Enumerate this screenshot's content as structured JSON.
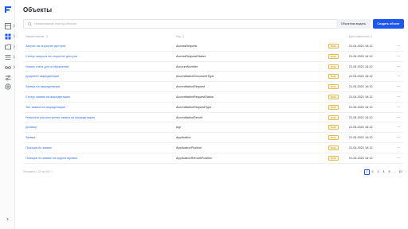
{
  "page": {
    "title": "Объекты"
  },
  "toolbar": {
    "search_placeholder": "Наименование или код объекта",
    "object_model_label": "Объектная модель",
    "create_label": "Создать объект"
  },
  "table": {
    "headers": {
      "name": "Наименование",
      "code": "Код",
      "changed": "Дата изменения"
    },
    "rows": [
      {
        "name": "Запрос на открытие доступа",
        "code": "AccessRequest",
        "badge": "Draft",
        "date": "21.04.2021  14:12"
      },
      {
        "name": "Статус запроса на открытие доступа",
        "code": "AccessRequestStatus",
        "badge": "Draft",
        "date": "21.04.2021  14:12"
      },
      {
        "name": "Номер счета для отображения",
        "code": "AccountNumber",
        "badge": "Draft",
        "date": "21.04.2021  14:12"
      },
      {
        "name": "Документ аккредитации",
        "code": "AccreditationDocumentType",
        "badge": "Draft",
        "date": "21.04.2021  14:12"
      },
      {
        "name": "Заявка на аккредитацию",
        "code": "AccreditationRequest",
        "badge": "Draft",
        "date": "21.04.2021  14:12"
      },
      {
        "name": "Статус заявки на аккредитацию",
        "code": "AccreditationRequestStatus",
        "badge": "Draft",
        "date": "21.04.2021  14:12"
      },
      {
        "name": "Тип заявки на аккредитацию",
        "code": "AccreditationRequestType",
        "badge": "Draft",
        "date": "21.04.2021  14:12"
      },
      {
        "name": "Результат рассмотрения заявки на аккредитацию",
        "code": "AccreditationResult",
        "badge": "Draft",
        "date": "21.04.2021  14:12"
      },
      {
        "name": "Договор",
        "code": "Agr",
        "badge": "Draft",
        "date": "21.04.2021  14:12"
      },
      {
        "name": "Заявка",
        "code": "Application",
        "badge": "Draft",
        "date": "21.04.2021  14:12"
      },
      {
        "name": "Позиция по заявке",
        "code": "ApplicationPosition",
        "badge": "Draft",
        "date": "21.04.2021  14:12"
      },
      {
        "name": "Позиция по заявке на корректировки",
        "code": "ApplicationRemarkPosition",
        "badge": "Draft",
        "date": "21.04.2021  14:12"
      }
    ],
    "row_menu_glyph": "···"
  },
  "footer": {
    "range_text": "Показано 1-20 из 200"
  },
  "pagination": {
    "prev": "‹",
    "pages": [
      "1",
      "2",
      "3",
      "4",
      "5",
      "...",
      "10"
    ],
    "active": "1",
    "next": "›"
  },
  "colors": {
    "accent": "#1e56f0",
    "link": "#2f6fe8",
    "badge_border": "#e9b949",
    "badge_bg": "#fff7e1"
  }
}
